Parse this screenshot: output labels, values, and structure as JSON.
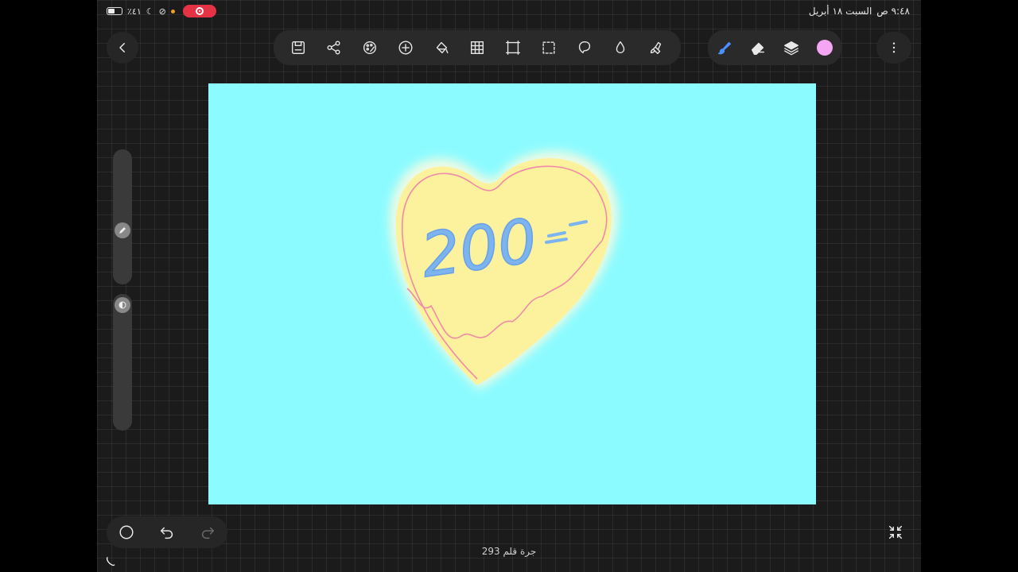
{
  "status_bar": {
    "battery_percent": "٪٤١",
    "time": "٩:٤٨ ص",
    "date": "السبت ١٨ أبريل"
  },
  "toolbar": {
    "left_tools": [
      "save-icon",
      "share-icon",
      "adjustments-icon",
      "add-icon",
      "fill-icon",
      "grid-icon",
      "crop-icon",
      "selection-icon",
      "lasso-icon",
      "drop-icon",
      "smudge-icon"
    ],
    "right_tools": [
      "brush-icon",
      "eraser-icon",
      "layers-icon"
    ],
    "current_color": "#f4a6f2"
  },
  "canvas": {
    "background": "#8cfbff",
    "drawn_text": "200"
  },
  "footer": {
    "stroke_count": "293 جرة قلم"
  }
}
